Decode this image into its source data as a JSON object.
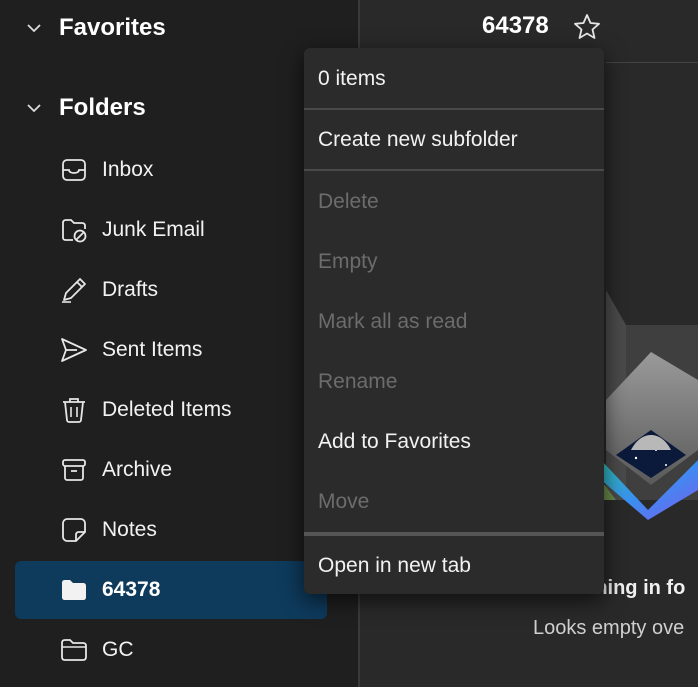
{
  "sidebar": {
    "favorites_label": "Favorites",
    "folders_label": "Folders",
    "folders": [
      {
        "label": "Inbox",
        "icon": "inbox-icon"
      },
      {
        "label": "Junk Email",
        "icon": "junk-icon"
      },
      {
        "label": "Drafts",
        "icon": "pencil-icon"
      },
      {
        "label": "Sent Items",
        "icon": "send-icon"
      },
      {
        "label": "Deleted Items",
        "icon": "trash-icon"
      },
      {
        "label": "Archive",
        "icon": "archive-icon"
      },
      {
        "label": "Notes",
        "icon": "note-icon"
      },
      {
        "label": "64378",
        "icon": "folder-filled-icon",
        "selected": true
      },
      {
        "label": "GC",
        "icon": "folder-icon"
      }
    ]
  },
  "header": {
    "title": "64378",
    "star_icon": "star-icon"
  },
  "context_menu": {
    "count": "0 items",
    "items": [
      {
        "label": "Create new subfolder",
        "enabled": true
      },
      {
        "label": "Delete",
        "enabled": false
      },
      {
        "label": "Empty",
        "enabled": false
      },
      {
        "label": "Mark all as read",
        "enabled": false
      },
      {
        "label": "Rename",
        "enabled": false
      },
      {
        "label": "Add to Favorites",
        "enabled": true
      },
      {
        "label": "Move",
        "enabled": false
      },
      {
        "label": "Open in new tab",
        "enabled": true
      }
    ]
  },
  "empty_state": {
    "title": "Nothing in fo",
    "subtitle": "Looks empty ove"
  },
  "colors": {
    "sidebar_bg": "#1f1f1f",
    "main_bg": "#292929",
    "selected_bg": "#0e3a5c",
    "menu_bg": "#2b2b2b",
    "disabled_text": "#6c6c6c"
  }
}
